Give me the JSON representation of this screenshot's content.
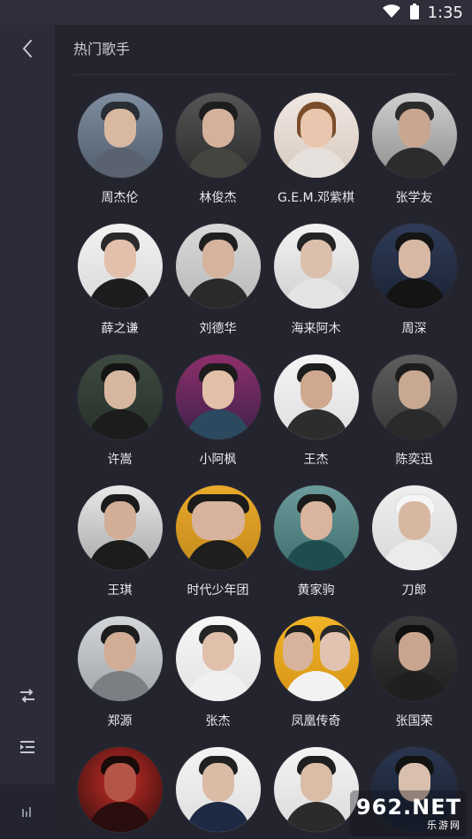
{
  "status_bar": {
    "time": "1:35",
    "icons": [
      "wifi-icon",
      "battery-icon"
    ]
  },
  "sidebar": {
    "items": [
      {
        "name": "back-icon"
      },
      {
        "name": "shuffle-icon"
      },
      {
        "name": "playlist-icon"
      },
      {
        "name": "equalizer-icon"
      }
    ]
  },
  "section": {
    "title": "热门歌手"
  },
  "artists": [
    {
      "name": "周杰伦"
    },
    {
      "name": "林俊杰"
    },
    {
      "name": "G.E.M.邓紫棋"
    },
    {
      "name": "张学友"
    },
    {
      "name": "薛之谦"
    },
    {
      "name": "刘德华"
    },
    {
      "name": "海来阿木"
    },
    {
      "name": "周深"
    },
    {
      "name": "许嵩"
    },
    {
      "name": "小阿枫"
    },
    {
      "name": "王杰"
    },
    {
      "name": "陈奕迅"
    },
    {
      "name": "王琪"
    },
    {
      "name": "时代少年团"
    },
    {
      "name": "黄家驹"
    },
    {
      "name": "刀郎"
    },
    {
      "name": "郑源"
    },
    {
      "name": "张杰"
    },
    {
      "name": "凤凰传奇"
    },
    {
      "name": "张国荣"
    },
    {
      "name": ""
    },
    {
      "name": ""
    },
    {
      "name": ""
    },
    {
      "name": ""
    }
  ],
  "watermark": {
    "logo": "962.NET",
    "sub": "乐游网"
  }
}
